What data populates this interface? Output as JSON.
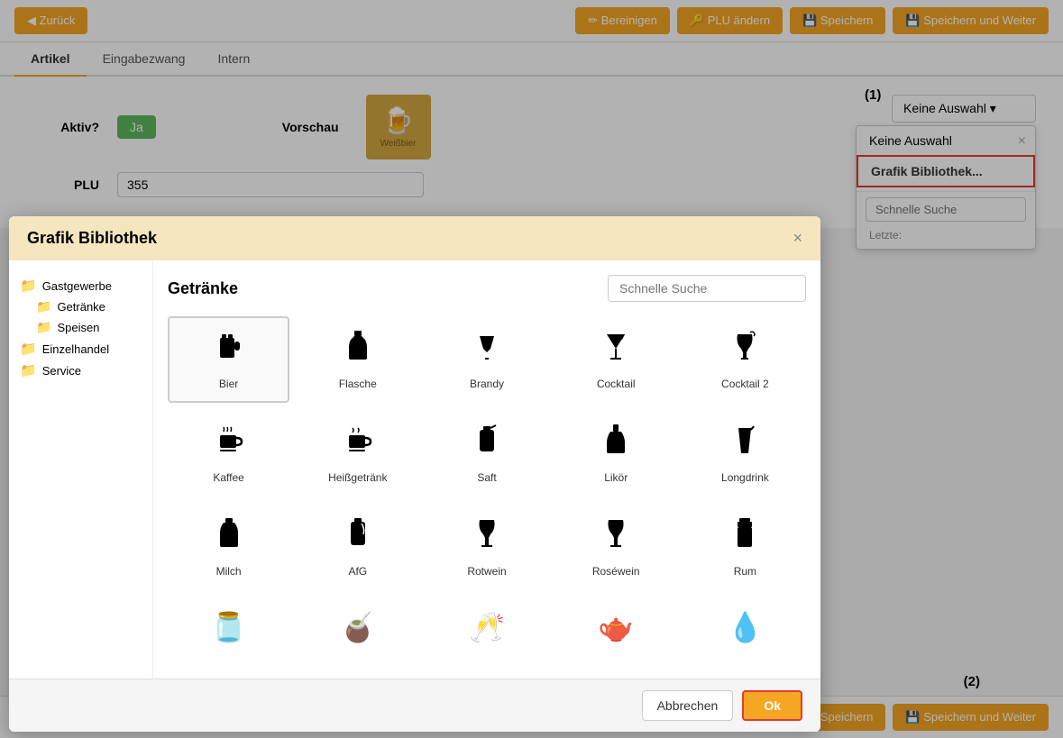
{
  "topBar": {
    "back_label": "◀ Zurück",
    "bereinigen_label": "✏ Bereinigen",
    "plu_label": "🔑 PLU ändern",
    "speichern_label": "💾 Speichern",
    "speichern_weiter_label": "💾 Speichern und Weiter"
  },
  "tabs": [
    {
      "label": "Artikel",
      "active": true
    },
    {
      "label": "Eingabezwang",
      "active": false
    },
    {
      "label": "Intern",
      "active": false
    }
  ],
  "form": {
    "aktiv_label": "Aktiv?",
    "ja_label": "Ja",
    "vorschau_label": "Vorschau",
    "plu_label": "PLU",
    "plu_value": "355",
    "keine_auswahl": "Keine Auswahl ▾"
  },
  "dropdown": {
    "keine_auswahl": "Keine Auswahl",
    "grafik_bibliothek": "Grafik Bibliothek...",
    "schnelle_suche_placeholder": "Schnelle Suche",
    "letzte_label": "Letzte:"
  },
  "modal": {
    "title": "Grafik Bibliothek",
    "close": "×",
    "category_title": "Getränke",
    "search_placeholder": "Schnelle Suche",
    "sidebar": {
      "folders": [
        {
          "label": "Gastgewerbe",
          "subfolders": [
            "Getränke",
            "Speisen"
          ]
        },
        {
          "label": "Einzelhandel",
          "subfolders": []
        },
        {
          "label": "Service",
          "subfolders": []
        }
      ]
    },
    "icons": [
      {
        "label": "Bier",
        "symbol": "🍺",
        "selected": true
      },
      {
        "label": "Flasche",
        "symbol": "🍾"
      },
      {
        "label": "Brandy",
        "symbol": "🥃"
      },
      {
        "label": "Cocktail",
        "symbol": "🍸"
      },
      {
        "label": "Cocktail 2",
        "symbol": "🍹"
      },
      {
        "label": "Kaffee",
        "symbol": "☕"
      },
      {
        "label": "Heißgetränk",
        "symbol": "🍵"
      },
      {
        "label": "Saft",
        "symbol": "🥤"
      },
      {
        "label": "Likör",
        "symbol": "🍶"
      },
      {
        "label": "Longdrink",
        "symbol": "🧃"
      },
      {
        "label": "Milch",
        "symbol": "🥛"
      },
      {
        "label": "AfG",
        "symbol": "🫗"
      },
      {
        "label": "Rotwein",
        "symbol": "🍷"
      },
      {
        "label": "Roséwein",
        "symbol": "🍷"
      },
      {
        "label": "Rum",
        "symbol": "🍫"
      },
      {
        "label": "",
        "symbol": "🫙"
      },
      {
        "label": "",
        "symbol": "🧉"
      },
      {
        "label": "",
        "symbol": "🥂"
      },
      {
        "label": "",
        "symbol": "🫖"
      },
      {
        "label": "",
        "symbol": "💧"
      }
    ],
    "cancel_label": "Abbrechen",
    "ok_label": "Ok"
  },
  "bottomBar": {
    "speichern_label": "💾 Speichern",
    "speichern_weiter_label": "💾 Speichern und Weiter"
  },
  "annotations": {
    "step1": "(1)",
    "step2": "(2)"
  }
}
